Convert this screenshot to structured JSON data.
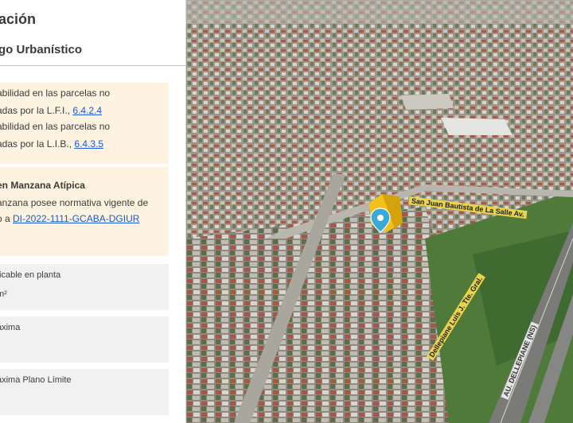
{
  "panel": {
    "title": "ación",
    "subtitle": "go Urbanístico",
    "card1": {
      "line1": "abilidad en las parcelas no",
      "line2a": "adas por la L.F.I., ",
      "link1": "6.4.2.4",
      "line3": "abilidad en las parcelas no",
      "line4a": "adas por la L.I.B., ",
      "link2": "6.4.3.5"
    },
    "card2": {
      "head": "en Manzana Atípica",
      "line1": "anzana posee normativa vigente de",
      "line2a": "o a ",
      "link": "DI-2022-1111-GCABA-DGIUR"
    },
    "card3": {
      "label": "ficable en planta",
      "value": "m²"
    },
    "card4": {
      "label": "áxima"
    },
    "card5": {
      "label": "áxima Plano Límite"
    }
  },
  "map": {
    "street_labels": [
      "San Juan Bautista de La Salle Av.",
      "Dellepiane Luis J. Tte. Gral.",
      "AU. DELLEPIANE (NS)"
    ],
    "pin_icon": "map-pin-icon",
    "colors": {
      "pin": "#3aa8d8",
      "building": "#f2c21b",
      "label_bg": "#e8d44a"
    }
  }
}
